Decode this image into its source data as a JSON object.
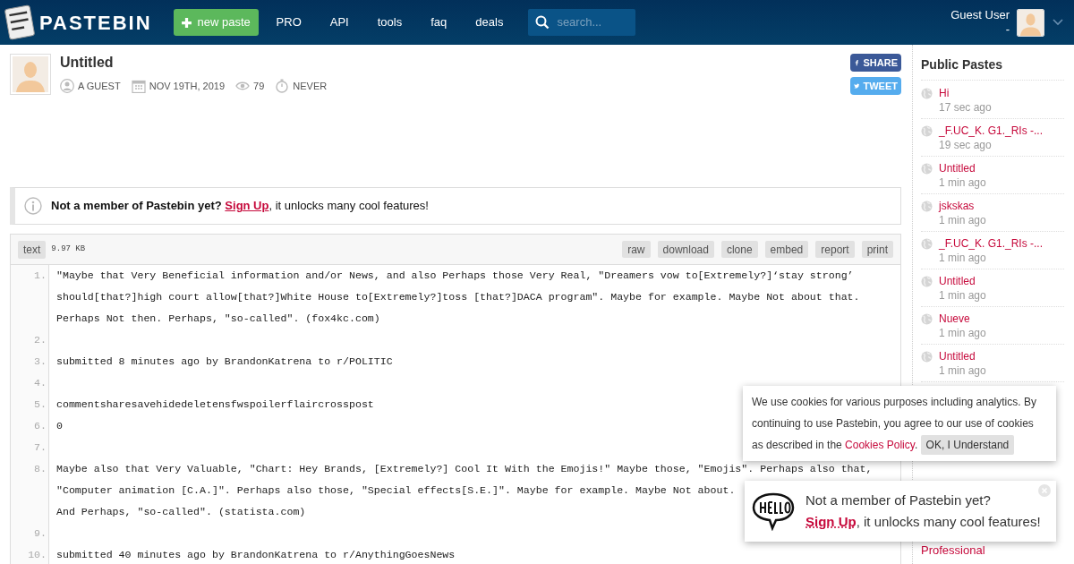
{
  "header": {
    "logo_text": "PASTEBIN",
    "new_paste": "new paste",
    "nav": [
      "PRO",
      "API",
      "tools",
      "faq",
      "deals"
    ],
    "search": {
      "placeholder": "search..."
    },
    "user": {
      "name": "Guest User",
      "sub": "-"
    }
  },
  "paste": {
    "title": "Untitled",
    "meta": [
      {
        "kind": "user",
        "text": "A GUEST"
      },
      {
        "kind": "date",
        "text": "NOV 19TH, 2019"
      },
      {
        "kind": "views",
        "text": "79"
      },
      {
        "kind": "expire",
        "text": "NEVER"
      }
    ],
    "share": [
      {
        "kind": "facebook",
        "label": "SHARE"
      },
      {
        "kind": "twitter",
        "label": "TWEET"
      }
    ]
  },
  "notice": {
    "text": "**Not a member of Pastebin yet?**",
    "link": "Sign Up",
    "rest": ", it unlocks many cool features!"
  },
  "code": {
    "syntax": "text",
    "size": "9.97 KB",
    "actions": [
      "raw",
      "download",
      "clone",
      "embed",
      "report",
      "print"
    ],
    "lines": [
      {
        "number": "1.",
        "rows": [
          "\"Maybe that Very Beneficial information and/or News, and also Perhaps those Very Real, \"Dreamers vow to[Extremely?]‘stay strong’",
          "should[that?]high court allow[that?]White House to[Extremely?]toss [that?]DACA program\". Maybe for example. Maybe Not about that.",
          "Perhaps Not then. Perhaps, \"so-called\". (fox4kc.com)"
        ]
      },
      {
        "number": "2."
      },
      {
        "number": "3.",
        "rows": [
          "submitted 8 minutes ago by BrandonKatrena to r/POLITIC"
        ]
      },
      {
        "number": "4."
      },
      {
        "number": "5.",
        "rows": [
          "commentsharesavehidedeletensfwspoilerflaircrosspost"
        ]
      },
      {
        "number": "6.",
        "rows": [
          "0"
        ]
      },
      {
        "number": "7."
      },
      {
        "number": "8.",
        "rows": [
          "Maybe also that Very Valuable, \"Chart: Hey Brands, [Extremely?] Cool It With the Emojis!\" Maybe those, \"Emojis\". Perhaps also that,",
          "\"Computer animation [C.A.]\". Perhaps also those, \"Special effects[S.E.]\". Maybe for example. Maybe Not about.",
          "And Perhaps, \"so-called\". (statista.com)"
        ]
      },
      {
        "number": "9."
      },
      {
        "number": "10.",
        "rows": [
          "submitted 40 minutes ago by BrandonKatrena to r/AnythingGoesNews"
        ]
      }
    ]
  },
  "sidebar": {
    "title": "Public Pastes",
    "items": [
      {
        "title": "Hi",
        "time": "17 sec ago"
      },
      {
        "title": "_F.UC_K. G1._RIs -...",
        "time": "19 sec ago"
      },
      {
        "title": "Untitled",
        "time": "1 min ago"
      },
      {
        "title": "jskskas",
        "time": "1 min ago"
      },
      {
        "title": "_F.UC_K. G1._RIs -...",
        "time": "1 min ago"
      },
      {
        "title": "Untitled",
        "time": "1 min ago"
      },
      {
        "title": "Nueve",
        "time": "1 min ago"
      },
      {
        "title": "Untitled",
        "time": "1 min ago"
      }
    ],
    "footer_link": "Professional"
  },
  "cookie": {
    "text": "We use cookies for various purposes including analytics. By continuing to use Pastebin, you agree to our use of cookies as described in the",
    "link": "Cookies Policy",
    "after": ".",
    "button": "OK, I Understand"
  },
  "hello": {
    "question": "Not a member of Pastebin yet?",
    "link": "Sign Up",
    "rest": ", it unlocks many cool features!"
  }
}
